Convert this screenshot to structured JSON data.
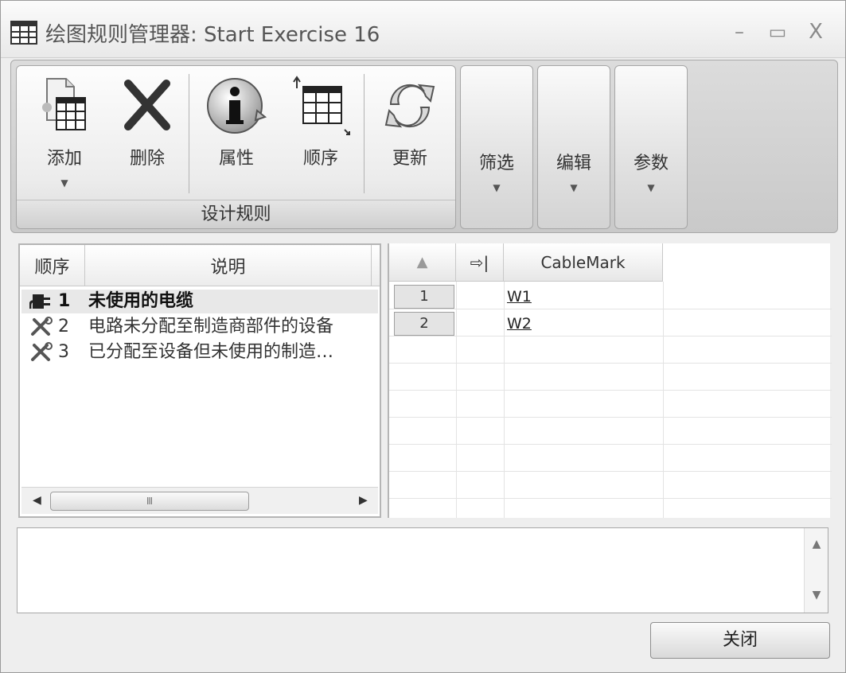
{
  "window": {
    "title": "绘图规则管理器: Start Exercise 16",
    "minimize": "–",
    "maximize": "▭",
    "close": "X"
  },
  "ribbon": {
    "group_label": "设计规则",
    "buttons": {
      "add": "添加",
      "delete": "删除",
      "properties": "属性",
      "order": "顺序",
      "update": "更新"
    },
    "dropdowns": {
      "filter": "筛选",
      "edit": "编辑",
      "params": "参数"
    },
    "dropdown_arrow": "▼"
  },
  "rules": {
    "columns": {
      "order": "顺序",
      "description": "说明"
    },
    "items": [
      {
        "num": "1",
        "text": "未使用的电缆",
        "selected": true
      },
      {
        "num": "2",
        "text": "电路未分配至制造商部件的设备",
        "selected": false
      },
      {
        "num": "3",
        "text": "已分配至设备但未使用的制造…",
        "selected": false
      }
    ],
    "scroll": {
      "left": "◀",
      "right": "▶",
      "thumb": "Ⅲ"
    }
  },
  "grid": {
    "columns": {
      "sort": "▲",
      "go": "⇨|",
      "mark": "CableMark"
    },
    "rows": [
      {
        "index": "1",
        "mark": "W1"
      },
      {
        "index": "2",
        "mark": "W2"
      }
    ]
  },
  "message": {
    "up": "▲",
    "down": "▼"
  },
  "footer": {
    "close_label": "关闭"
  }
}
